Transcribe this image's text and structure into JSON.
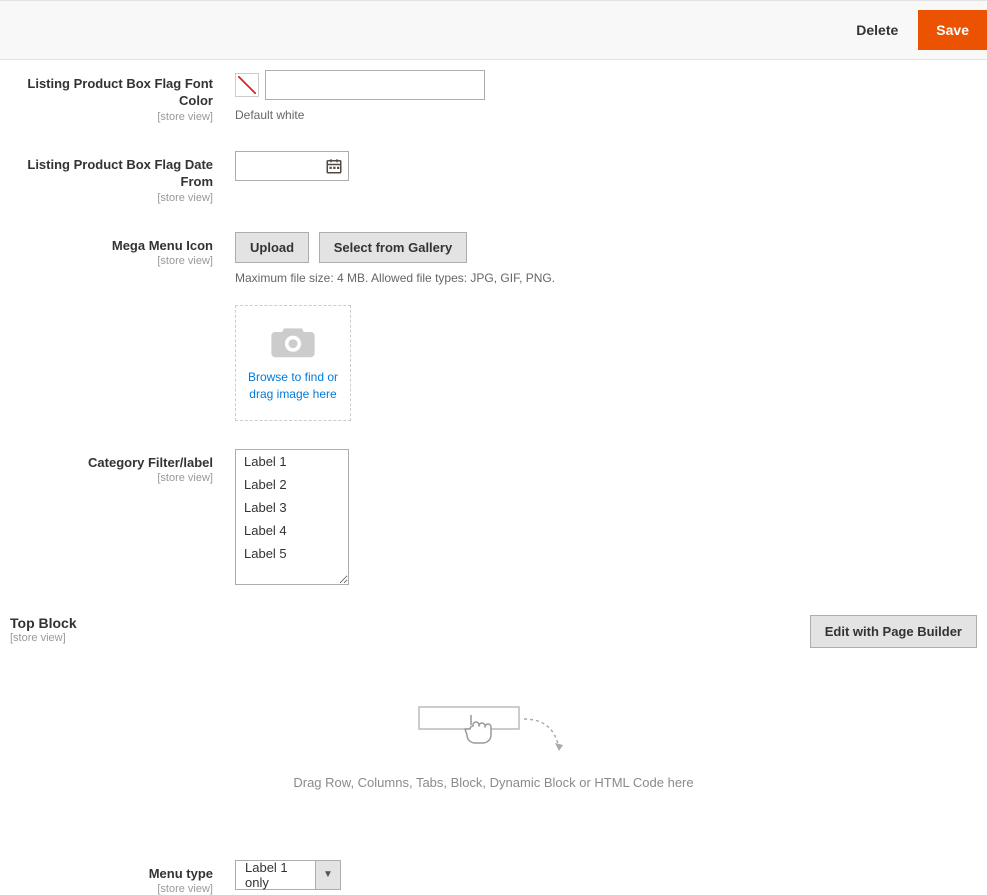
{
  "header": {
    "delete_label": "Delete",
    "save_label": "Save"
  },
  "scope_label": "[store view]",
  "fields": {
    "font_color": {
      "label": "Listing Product Box Flag Font Color",
      "value": "",
      "hint": "Default white"
    },
    "date_from": {
      "label": "Listing Product Box Flag Date From",
      "value": ""
    },
    "mega_menu_icon": {
      "label": "Mega Menu Icon",
      "upload_label": "Upload",
      "gallery_label": "Select from Gallery",
      "hint": "Maximum file size: 4 MB. Allowed file types: JPG, GIF, PNG.",
      "dropzone_text": "Browse to find or drag image here"
    },
    "category_filter": {
      "label": "Category Filter/label",
      "options": [
        "Label 1",
        "Label 2",
        "Label 3",
        "Label 4",
        "Label 5"
      ]
    },
    "top_block": {
      "label": "Top Block",
      "edit_label": "Edit with Page Builder",
      "placeholder": "Drag Row, Columns, Tabs, Block, Dynamic Block or HTML Code here"
    },
    "menu_type": {
      "label": "Menu type",
      "value": "Label 1 only"
    }
  }
}
